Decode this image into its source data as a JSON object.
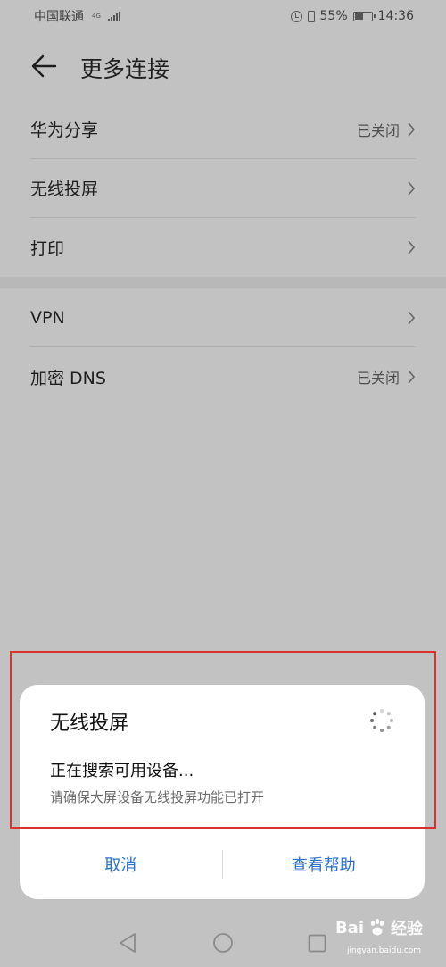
{
  "status_bar": {
    "carrier": "中国联通",
    "network": "4G",
    "battery": "55%",
    "battery_level": 0.55,
    "time": "14:36"
  },
  "header": {
    "title": "更多连接"
  },
  "settings_group_1": [
    {
      "label": "华为分享",
      "value": "已关闭"
    },
    {
      "label": "无线投屏",
      "value": ""
    },
    {
      "label": "打印",
      "value": ""
    }
  ],
  "settings_group_2": [
    {
      "label": "VPN",
      "value": ""
    },
    {
      "label": "加密 DNS",
      "value": "已关闭"
    }
  ],
  "dialog": {
    "title": "无线投屏",
    "message": "正在搜索可用设备...",
    "hint": "请确保大屏设备无线投屏功能已打开",
    "cancel_label": "取消",
    "help_label": "查看帮助"
  },
  "watermark": {
    "text": "Bai",
    "suffix": "经验",
    "url": "jingyan.baidu.com"
  },
  "colors": {
    "accent": "#2b73c4",
    "highlight": "#d9312b"
  }
}
